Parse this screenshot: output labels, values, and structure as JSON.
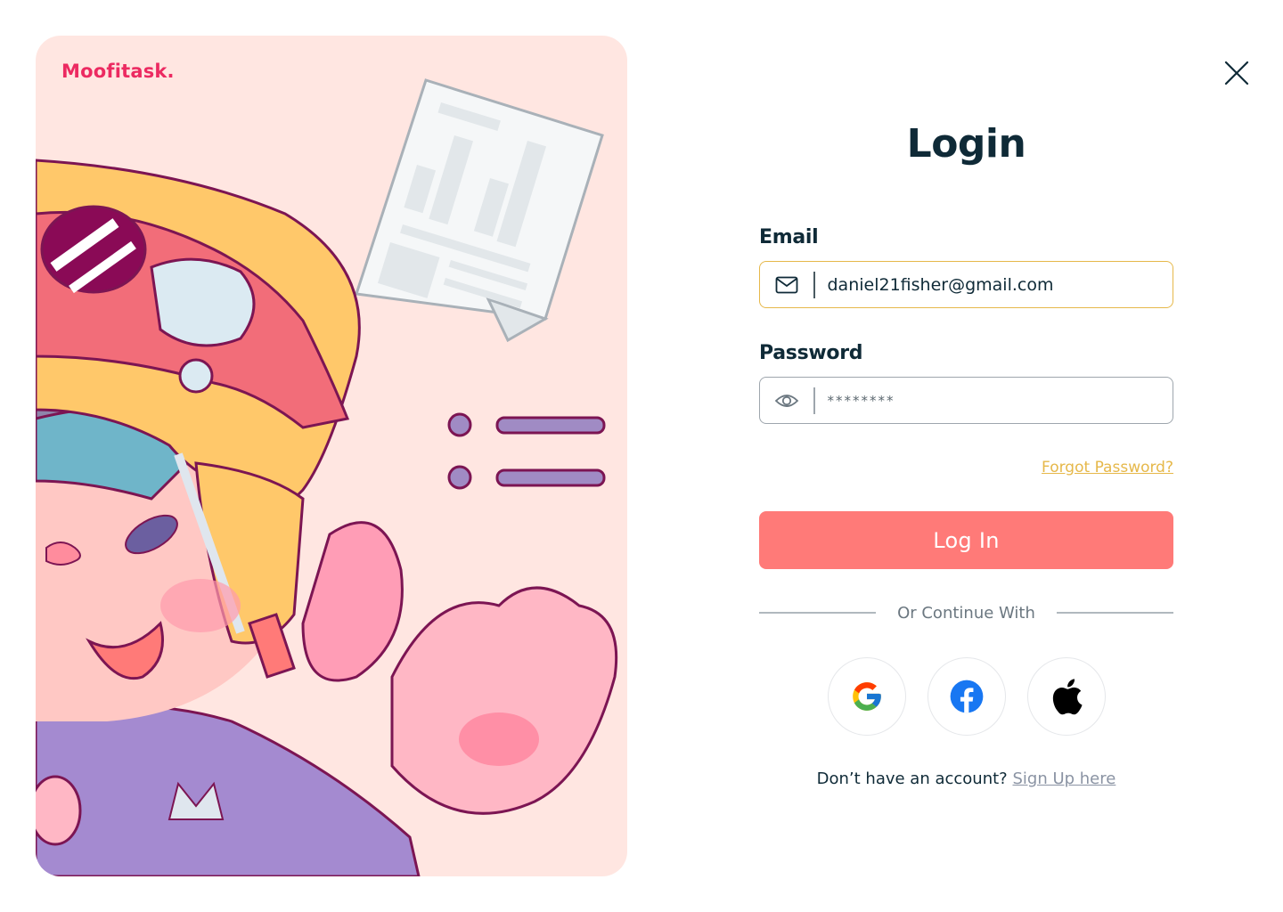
{
  "brand": {
    "name": "Moofitask."
  },
  "login": {
    "title": "Login",
    "email_label": "Email",
    "email_value": "daniel21fisher@gmail.com",
    "password_label": "Password",
    "password_value": "********",
    "forgot_link": "Forgot Password?",
    "submit_label": "Log In",
    "divider_text": "Or Continue With",
    "signup_prompt": "Don’t have an account?",
    "signup_link": "Sign Up here"
  },
  "social": [
    {
      "name": "google",
      "icon": "google-icon"
    },
    {
      "name": "facebook",
      "icon": "facebook-icon"
    },
    {
      "name": "apple",
      "icon": "apple-icon"
    }
  ],
  "colors": {
    "accent": "#ff7a78",
    "brand": "#ec2a61",
    "link_gold": "#e6b84a",
    "panel_bg": "#ffe6e1"
  }
}
